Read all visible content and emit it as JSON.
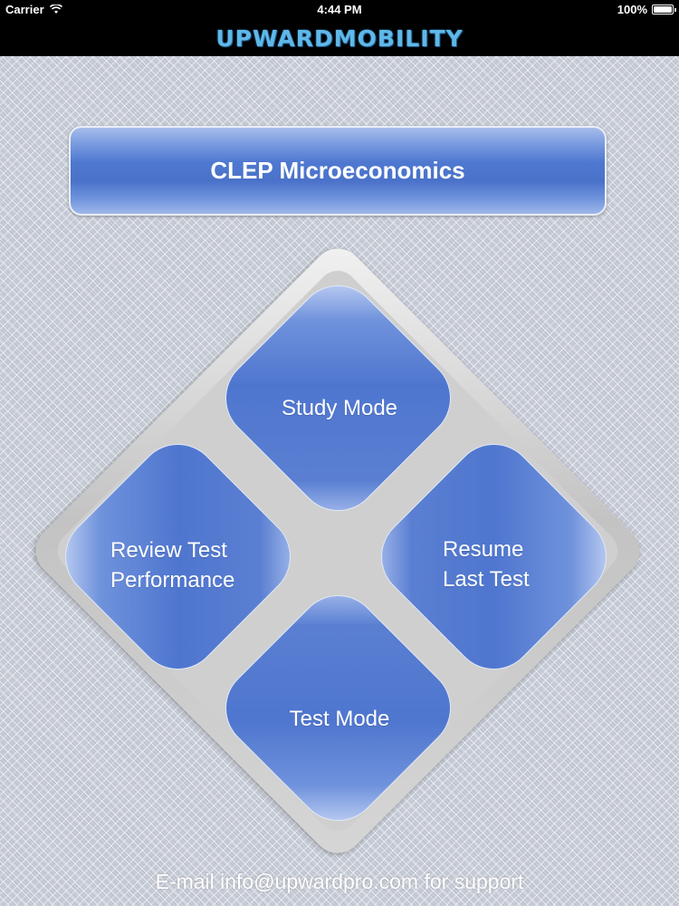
{
  "status_bar": {
    "carrier": "Carrier",
    "time": "4:44 PM",
    "battery": "100%",
    "battery_level": 1.0
  },
  "header": {
    "logo_text": "UPWARDMOBILITY"
  },
  "title_button": {
    "label": "CLEP Microeconomics"
  },
  "menu": {
    "study_mode": "Study Mode",
    "test_mode": "Test Mode",
    "review_performance": "Review Test\nPerformance",
    "resume_last_test": "Resume\nLast Test"
  },
  "footer": {
    "support_text": "E-mail info@upwardpro.com for support"
  },
  "colors": {
    "accent_blue": "#4f76cf",
    "header_bg": "#000000",
    "background": "#c9ced8"
  }
}
